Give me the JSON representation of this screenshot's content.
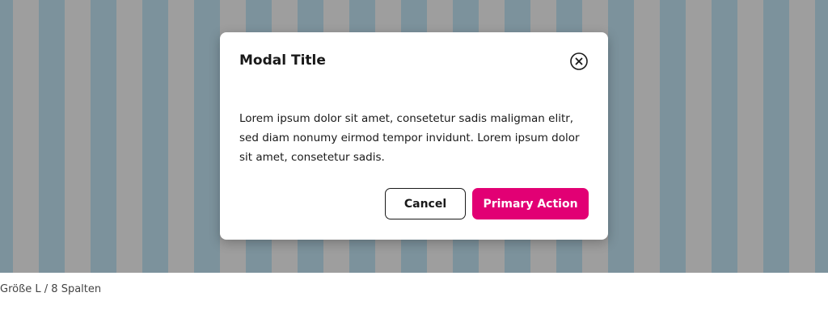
{
  "modal": {
    "title": "Modal Title",
    "close_icon": "close-circle-icon",
    "body": "Lorem ipsum dolor sit amet, consetetur sadis maligman elitr, sed diam nonumy eirmod tempor invidunt. Lorem ipsum dolor sit amet, consetetur sadis.",
    "cancel_label": "Cancel",
    "primary_label": "Primary Action"
  },
  "caption": "Größe L / 8 Spalten",
  "colors": {
    "primary": "#e20074",
    "grid_column": "#7c929c",
    "grid_gutter": "#9e9e9e",
    "text": "#191919"
  }
}
